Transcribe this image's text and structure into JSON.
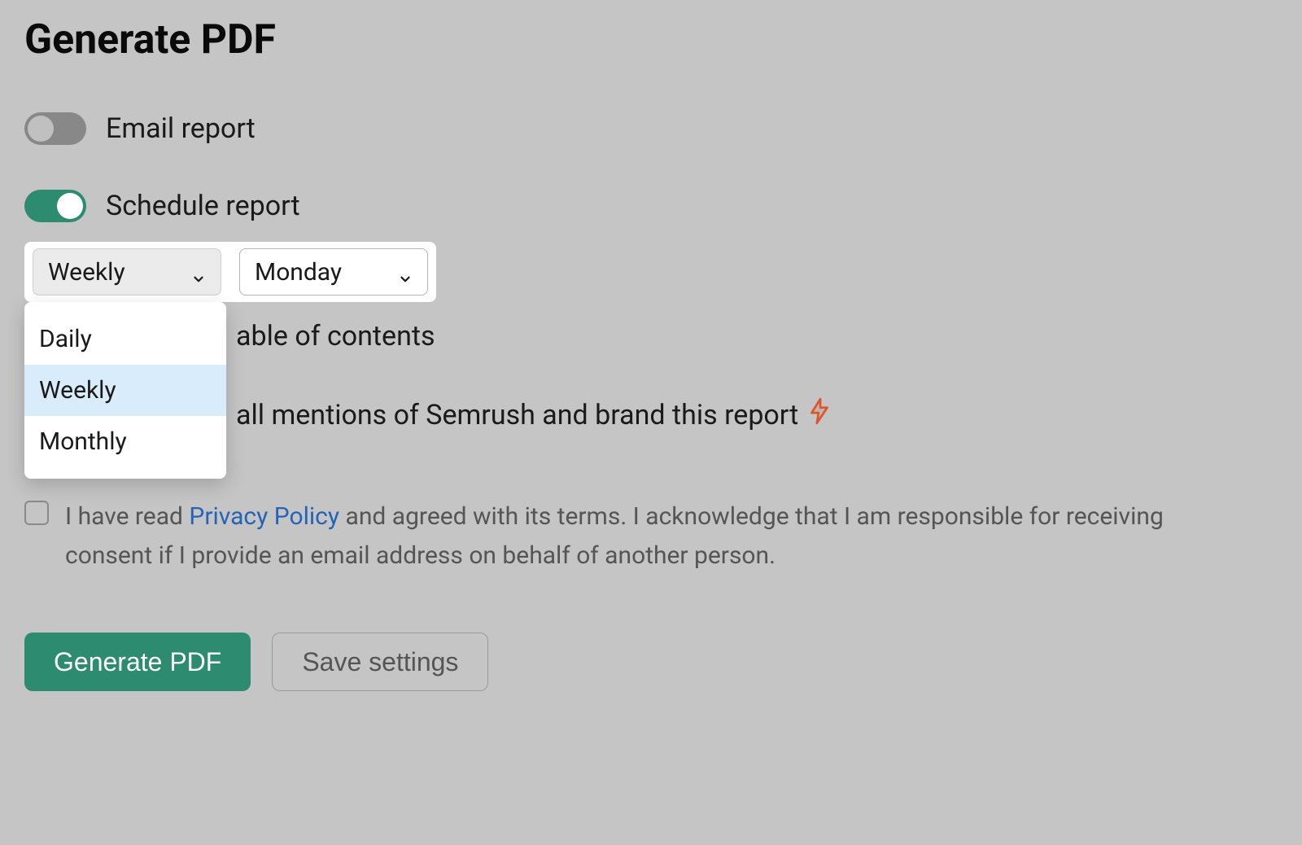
{
  "title": "Generate PDF",
  "toggles": {
    "email_report": {
      "label": "Email report",
      "on": false
    },
    "schedule_report": {
      "label": "Schedule report",
      "on": true
    }
  },
  "schedule": {
    "frequency_selected": "Weekly",
    "day_selected": "Monday",
    "frequency_options": [
      "Daily",
      "Weekly",
      "Monthly"
    ]
  },
  "options": {
    "table_of_contents_fragment": "able of contents",
    "branding_fragment": "all mentions of Semrush and brand this report"
  },
  "privacy": {
    "prefix": "I have read ",
    "link": "Privacy Policy",
    "suffix": " and agreed with its terms. I acknowledge that I am responsible for receiving consent if I provide an email address on behalf of another person."
  },
  "buttons": {
    "generate": "Generate PDF",
    "save": "Save settings"
  }
}
